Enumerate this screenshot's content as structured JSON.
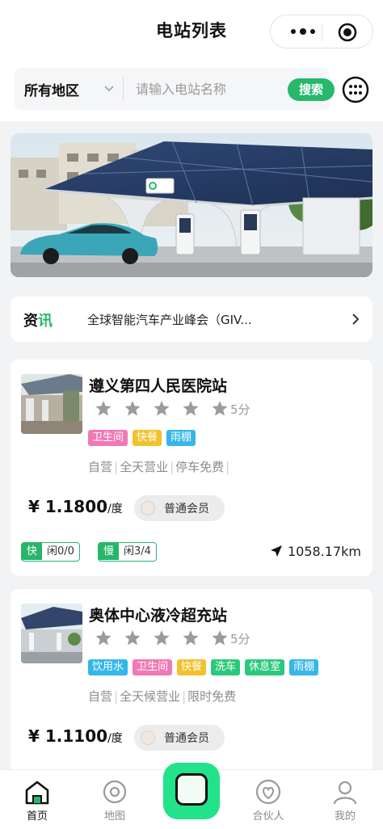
{
  "nav": {
    "title": "电站列表",
    "capsule": {
      "more_icon": "more-dots-icon",
      "close_icon": "target-circle-icon"
    }
  },
  "search": {
    "region": "所有地区",
    "placeholder": "请输入电站名称",
    "button": "搜索",
    "menu_icon": "grid-menu-icon"
  },
  "banner": {
    "image": "charging-station-photo"
  },
  "news": {
    "tag": "资讯",
    "text": "全球智能汽车产业峰会（GIV..."
  },
  "colors": {
    "brand_green": "#26b96b",
    "tag_pink": "#f07ab4",
    "tag_yellow": "#f2c22e",
    "tag_blue": "#35b7e8",
    "tag_green": "#2bc97b",
    "center_button": "#22e38a"
  },
  "stations": [
    {
      "name": "遵义第四人民医院站",
      "score": "5分",
      "rating": 5,
      "tags": [
        {
          "label": "卫生间",
          "color": "#f07ab4"
        },
        {
          "label": "快餐",
          "color": "#f2c22e"
        },
        {
          "label": "雨棚",
          "color": "#35b7e8"
        }
      ],
      "features": [
        "自营",
        "全天营业",
        "停车免费"
      ],
      "price": "¥ 1.1800",
      "price_unit": "/度",
      "member": "普通会员",
      "fast_label": "快",
      "fast_value": "闲0/0",
      "slow_label": "慢",
      "slow_value": "闲3/4",
      "distance": "1058.17km"
    },
    {
      "name": "奥体中心液冷超充站",
      "score": "5分",
      "rating": 5,
      "tags": [
        {
          "label": "饮用水",
          "color": "#35b7e8"
        },
        {
          "label": "卫生间",
          "color": "#f07ab4"
        },
        {
          "label": "快餐",
          "color": "#f2c22e"
        },
        {
          "label": "洗车",
          "color": "#2bc97b"
        },
        {
          "label": "休息室",
          "color": "#2bc97b"
        },
        {
          "label": "雨棚",
          "color": "#35b7e8"
        }
      ],
      "features": [
        "自营",
        "全天候营业",
        "限时免费"
      ],
      "price": "¥ 1.1100",
      "price_unit": "/度",
      "member": "普通会员"
    }
  ],
  "tabbar": [
    {
      "label": "首页",
      "icon": "home-icon",
      "active": true
    },
    {
      "label": "地图",
      "icon": "map-pin-icon",
      "active": false
    },
    {
      "label": "",
      "icon": "scan-square-icon",
      "active": false
    },
    {
      "label": "合伙人",
      "icon": "partner-heart-icon",
      "active": false
    },
    {
      "label": "我的",
      "icon": "user-icon",
      "active": false
    }
  ]
}
